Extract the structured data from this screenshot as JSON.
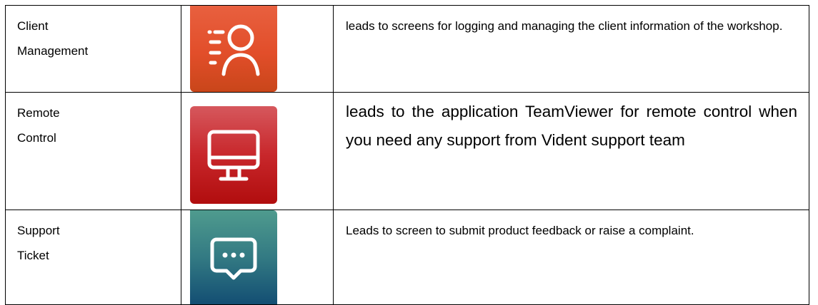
{
  "rows": [
    {
      "label_line1": "Client",
      "label_line2": "Management",
      "icon": "client-management-icon",
      "icon_color": "#e2542d",
      "description": "leads to screens for logging and managing the client information of the workshop."
    },
    {
      "label_line1": "Remote",
      "label_line2": "Control",
      "icon": "monitor-icon",
      "icon_color": "#c21e21",
      "description": "leads to the application TeamViewer for remote control when you need any support from Vident support team"
    },
    {
      "label_line1": "Support",
      "label_line2": "Ticket",
      "icon": "chat-bubble-icon",
      "icon_color": "#2f7380",
      "description": "Leads to screen to submit product feedback or raise a complaint."
    }
  ]
}
